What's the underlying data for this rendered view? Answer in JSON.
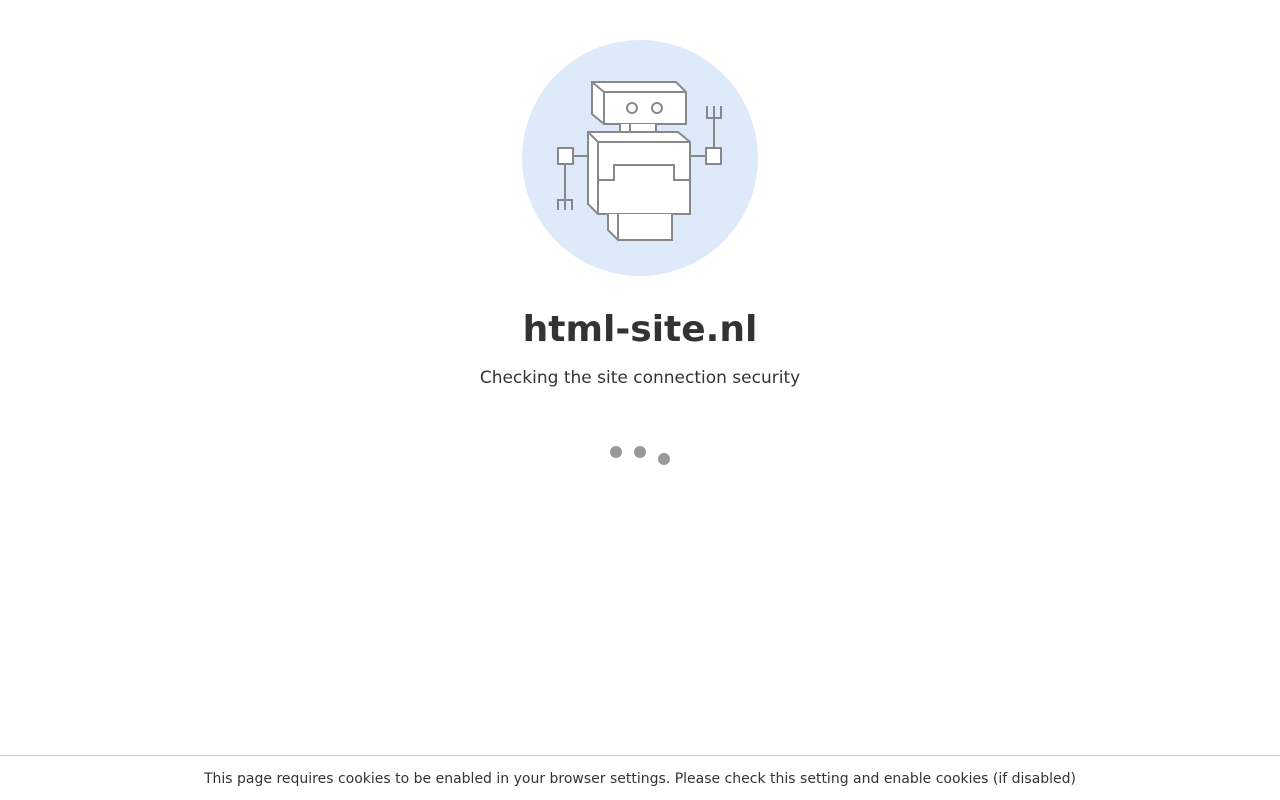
{
  "header": {
    "site_name": "html-site.nl",
    "status_text": "Checking the site connection security"
  },
  "illustration": {
    "icon": "robot-icon",
    "background_color": "#deeafa",
    "stroke_color": "#888888"
  },
  "loader": {
    "icon": "loading-dots",
    "dot_color": "#999999"
  },
  "footer": {
    "notice": "This page requires cookies to be enabled in your browser settings. Please check this setting and enable cookies (if disabled)"
  }
}
